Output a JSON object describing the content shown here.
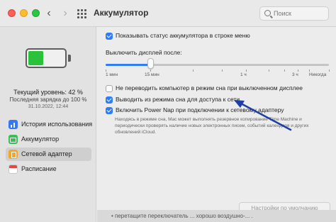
{
  "window": {
    "title": "Аккумулятор"
  },
  "search": {
    "placeholder": "Поиск"
  },
  "battery": {
    "level_text": "Текущий уровень: 42 %",
    "level_fraction": 0.42,
    "last_charge": "Последняя зарядка до 100 %",
    "last_charge_date": "31.10.2022, 12:44"
  },
  "sidebar": {
    "items": [
      {
        "label": "История использования",
        "icon": "chart-icon"
      },
      {
        "label": "Аккумулятор",
        "icon": "battery-icon"
      },
      {
        "label": "Сетевой адаптер",
        "icon": "power-adapter-icon",
        "selected": true
      },
      {
        "label": "Расписание",
        "icon": "calendar-icon"
      }
    ]
  },
  "settings": {
    "show_status": {
      "label": "Показывать статус аккумулятора в строке меню",
      "checked": true
    },
    "display_off": {
      "label": "Выключить дисплей после:",
      "value_fraction": 0.2,
      "ticks": [
        "1 мин",
        "15 мин",
        "1 ч",
        "3 ч",
        "Никогда"
      ]
    },
    "prevent_sleep": {
      "label": "Не переводить компьютер в режим сна при выключенном дисплее",
      "checked": false
    },
    "wake_network": {
      "label": "Выводить из режима сна для доступа к сети",
      "checked": true
    },
    "power_nap": {
      "label": "Включить Power Nap при подключении к сетевому адаптеру",
      "checked": true,
      "note": "Находясь в режиме сна, Mac может выполнять резервное копирование Time Machine и периодически проверять наличие новых электронных писем, событий календаря и других обновлений iCloud."
    },
    "defaults_button": "Настройки по умолчанию"
  },
  "background": {
    "paper_text": "• перетащите переключатель ... хорошо воздушно-... ."
  },
  "colors": {
    "accent": "#2f7df6",
    "battery_green": "#29c23a",
    "arrow": "#1f3fa6"
  }
}
